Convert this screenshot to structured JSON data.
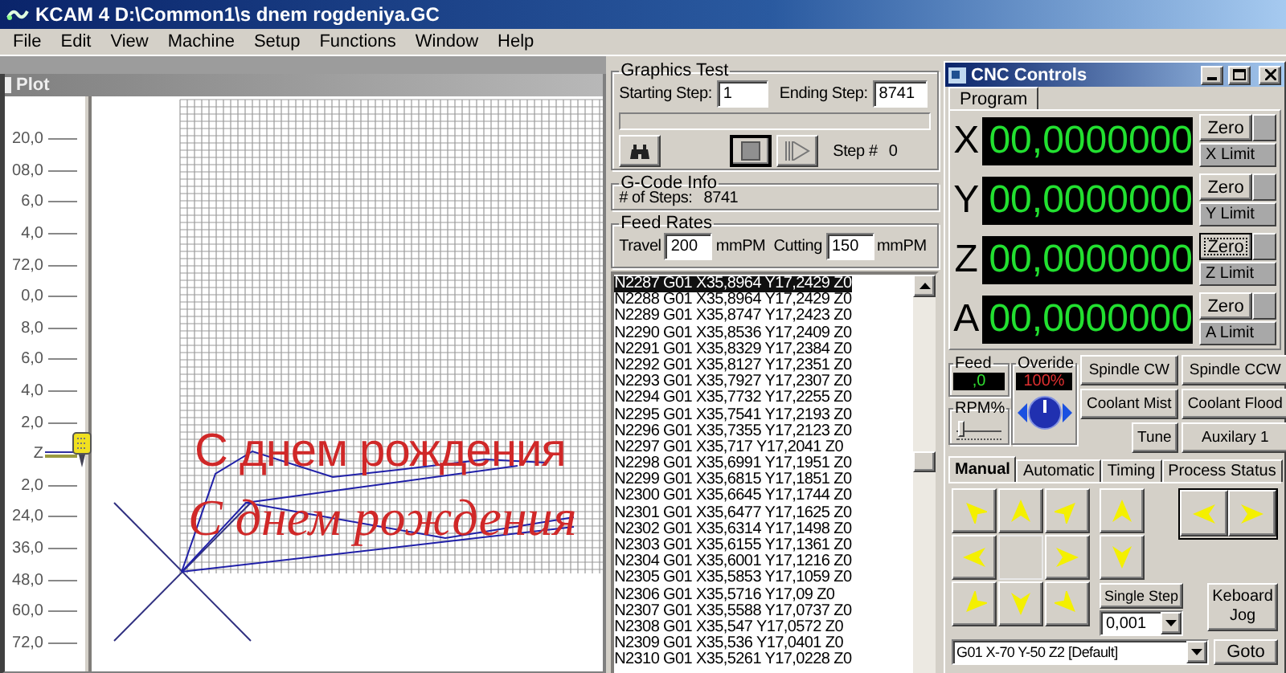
{
  "window": {
    "title": "KCAM 4  D:\\Common1\\s dnem rogdeniya.GC"
  },
  "menu": [
    "File",
    "Edit",
    "View",
    "Machine",
    "Setup",
    "Functions",
    "Window",
    "Help"
  ],
  "plot": {
    "title": "Plot",
    "ruler": [
      {
        "label": "20,0",
        "kind": "tick"
      },
      {
        "label": "08,0",
        "kind": "tick"
      },
      {
        "label": "6,0",
        "kind": "tick"
      },
      {
        "label": "4,0",
        "kind": "tick"
      },
      {
        "label": "72,0",
        "kind": "tick"
      },
      {
        "label": "0,0",
        "kind": "tick"
      },
      {
        "label": "8,0",
        "kind": "tick"
      },
      {
        "label": "6,0",
        "kind": "tick"
      },
      {
        "label": "4,0",
        "kind": "tick"
      },
      {
        "label": "2,0",
        "kind": "tick"
      },
      {
        "label": "Z",
        "kind": "zero"
      },
      {
        "label": "2,0",
        "kind": "tick"
      },
      {
        "label": "24,0",
        "kind": "tick"
      },
      {
        "label": "36,0",
        "kind": "tick"
      },
      {
        "label": "48,0",
        "kind": "tick"
      },
      {
        "label": "60,0",
        "kind": "tick"
      },
      {
        "label": "72,0",
        "kind": "tick"
      }
    ],
    "texts": [
      {
        "text": "С днем рождения",
        "kind": "upright"
      },
      {
        "text": "С днем рождения",
        "kind": "italic"
      }
    ]
  },
  "graphics_test": {
    "title": "Graphics Test",
    "starting_label": "Starting Step:",
    "starting": "1",
    "ending_label": "Ending Step:",
    "ending": "8741",
    "progress": {
      "level": 0
    },
    "step_label": "Step #",
    "step": "0"
  },
  "gcode_info": {
    "title": "G-Code Info",
    "steps_label": "# of Steps:",
    "steps": "8741"
  },
  "feed_rates": {
    "title": "Feed Rates",
    "travel_label": "Travel",
    "travel": "200",
    "travel_unit": "mmPM",
    "cutting_label": "Cutting",
    "cutting": "150",
    "cutting_unit": "mmPM"
  },
  "gcode": {
    "lines": [
      {
        "text": "N2287 G01 X35,8964 Y17,2429 Z0",
        "selected": true
      },
      {
        "text": "N2288 G01 X35,8964 Y17,2429 Z0",
        "selected": false
      },
      {
        "text": "N2289 G01 X35,8747 Y17,2423 Z0",
        "selected": false
      },
      {
        "text": "N2290 G01 X35,8536 Y17,2409 Z0",
        "selected": false
      },
      {
        "text": "N2291 G01 X35,8329 Y17,2384 Z0",
        "selected": false
      },
      {
        "text": "N2292 G01 X35,8127 Y17,2351 Z0",
        "selected": false
      },
      {
        "text": "N2293 G01 X35,7927 Y17,2307 Z0",
        "selected": false
      },
      {
        "text": "N2294 G01 X35,7732 Y17,2255 Z0",
        "selected": false
      },
      {
        "text": "N2295 G01 X35,7541 Y17,2193 Z0",
        "selected": false
      },
      {
        "text": "N2296 G01 X35,7355 Y17,2123 Z0",
        "selected": false
      },
      {
        "text": "N2297 G01 X35,717 Y17,2041 Z0",
        "selected": false
      },
      {
        "text": "N2298 G01 X35,6991 Y17,1951 Z0",
        "selected": false
      },
      {
        "text": "N2299 G01 X35,6815 Y17,1851 Z0",
        "selected": false
      },
      {
        "text": "N2300 G01 X35,6645 Y17,1744 Z0",
        "selected": false
      },
      {
        "text": "N2301 G01 X35,6477 Y17,1625 Z0",
        "selected": false
      },
      {
        "text": "N2302 G01 X35,6314 Y17,1498 Z0",
        "selected": false
      },
      {
        "text": "N2303 G01 X35,6155 Y17,1361 Z0",
        "selected": false
      },
      {
        "text": "N2304 G01 X35,6001 Y17,1216 Z0",
        "selected": false
      },
      {
        "text": "N2305 G01 X35,5853 Y17,1059 Z0",
        "selected": false
      },
      {
        "text": "N2306 G01 X35,5716 Y17,09 Z0",
        "selected": false
      },
      {
        "text": "N2307 G01 X35,5588 Y17,0737 Z0",
        "selected": false
      },
      {
        "text": "N2308 G01 X35,547 Y17,0572 Z0",
        "selected": false
      },
      {
        "text": "N2309 G01 X35,536 Y17,0401 Z0",
        "selected": false
      },
      {
        "text": "N2310 G01 X35,5261 Y17,0228 Z0",
        "selected": false
      }
    ]
  },
  "cnc": {
    "title": "CNC Controls",
    "tabs": [
      {
        "label": "Program",
        "selected": true
      }
    ],
    "axes": [
      {
        "axis": "X",
        "value": "00,0000000",
        "zero": "Zero",
        "focused": false,
        "limit": "X Limit"
      },
      {
        "axis": "Y",
        "value": "00,0000000",
        "zero": "Zero",
        "focused": false,
        "limit": "Y Limit"
      },
      {
        "axis": "Z",
        "value": "00,0000000",
        "zero": "Zero",
        "focused": true,
        "limit": "Z Limit"
      },
      {
        "axis": "A",
        "value": "00,0000000",
        "zero": "Zero",
        "focused": false,
        "limit": "A Limit"
      }
    ],
    "feed": {
      "title": "Feed",
      "value": ",0"
    },
    "override": {
      "title": "Overide",
      "value": "100%"
    },
    "rpm": {
      "label": "RPM%",
      "level": 0.1
    },
    "buttons": [
      "Spindle CW",
      "Spindle CCW",
      "Coolant Mist",
      "Coolant Flood",
      "Tune",
      "Auxilary 1"
    ],
    "mode_tabs": [
      {
        "label": "Manual",
        "selected": true
      },
      {
        "label": "Automatic",
        "selected": false
      },
      {
        "label": "Timing",
        "selected": false
      },
      {
        "label": "Process Status",
        "selected": false
      }
    ],
    "single_step": {
      "label": "Single Step",
      "value": "0,001"
    },
    "keyboard_jog": "Keboard Jog",
    "command": {
      "value": "G01 X-70 Y-50 Z2 [Default]"
    },
    "goto": "Goto"
  }
}
